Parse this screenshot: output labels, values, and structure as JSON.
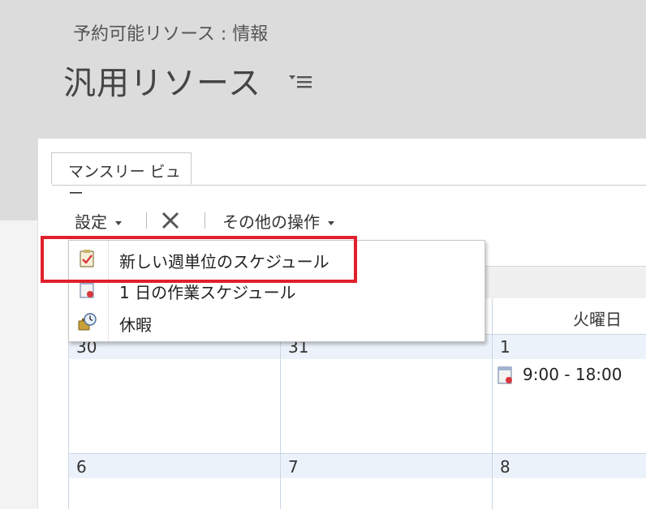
{
  "header": {
    "entity_type": "予約可能リソース : 情報",
    "entity_name": "汎用リソース"
  },
  "tabs": [
    {
      "label": "マンスリー ビュー"
    }
  ],
  "toolbar": {
    "settings_label": "設定",
    "other_actions_label": "その他の操作"
  },
  "menu": {
    "items": [
      {
        "label": "新しい週単位のスケジュール",
        "icon": "weekly-schedule-icon"
      },
      {
        "label": "1 日の作業スケジュール",
        "icon": "daily-schedule-icon"
      },
      {
        "label": "休暇",
        "icon": "time-off-icon"
      }
    ]
  },
  "calendar": {
    "day_names": [
      "火曜日"
    ],
    "week1": [
      "30",
      "31",
      "1"
    ],
    "week2": [
      "6",
      "7",
      "8"
    ],
    "event": {
      "time": "9:00 - 18:00",
      "icon": "schedule-entry-icon"
    }
  },
  "colors": {
    "highlight": "#e0202b",
    "header_bg": "#dcdcdc",
    "week_band": "#ecf2fa"
  }
}
